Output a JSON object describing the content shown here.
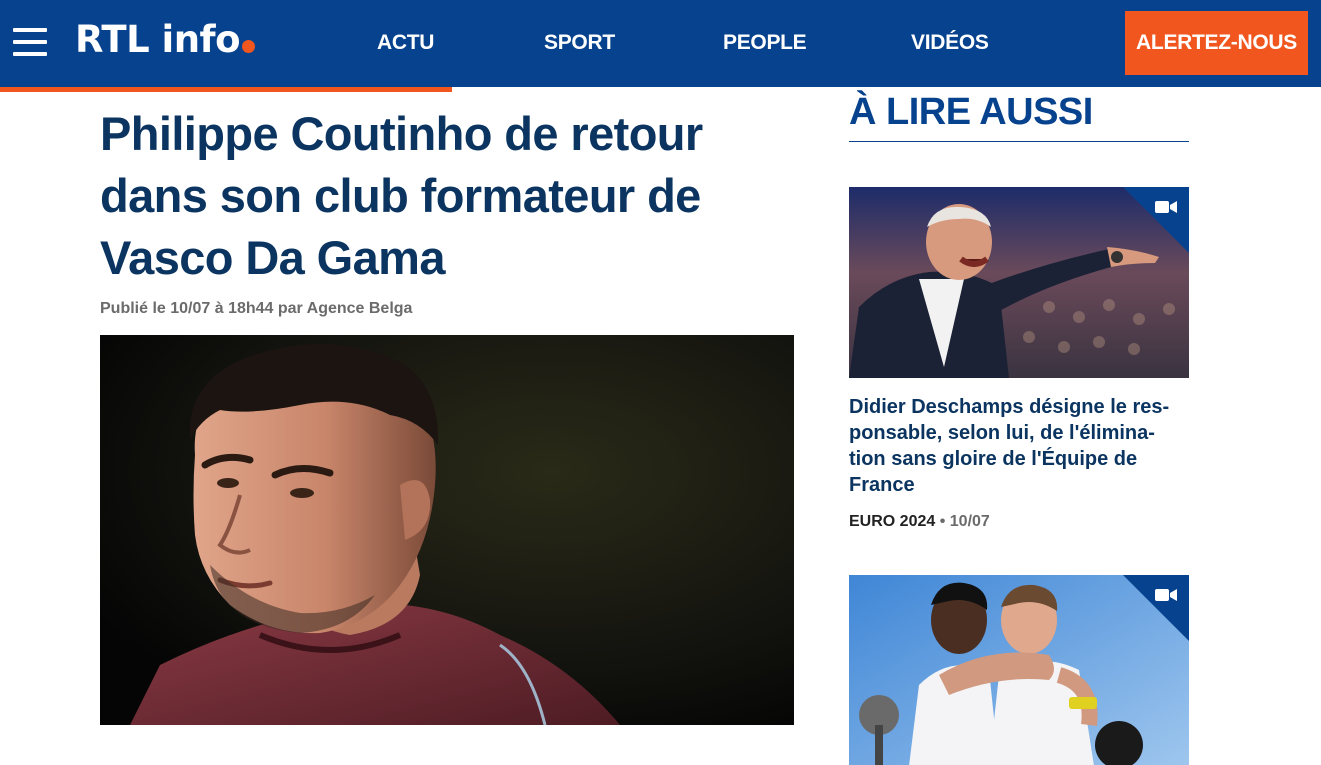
{
  "header": {
    "logo_text": "RTL info",
    "nav": [
      "ACTU",
      "SPORT",
      "PEOPLE",
      "VIDÉOS"
    ],
    "cta_label": "ALERTEZ-NOUS",
    "colors": {
      "bar": "#06428d",
      "accent": "#f0561d"
    }
  },
  "article": {
    "title": "Philippe Coutinho de retour dans son club formateur de Vasco Da Gama",
    "byline": "Publié le 10/07 à 18h44 par Agence Belga",
    "reading_progress_percent": 34
  },
  "sidebar": {
    "heading": "À LIRE AUSSI",
    "cards": [
      {
        "title": "Didier Deschamps désigne le res- ponsable, selon lui, de l'élimina- tion sans gloire de l'Équipe de France",
        "category": "EURO 2024",
        "separator": "•",
        "date": "10/07",
        "badge_icon": "video-camera-icon"
      },
      {
        "badge_icon": "video-camera-icon"
      }
    ]
  }
}
